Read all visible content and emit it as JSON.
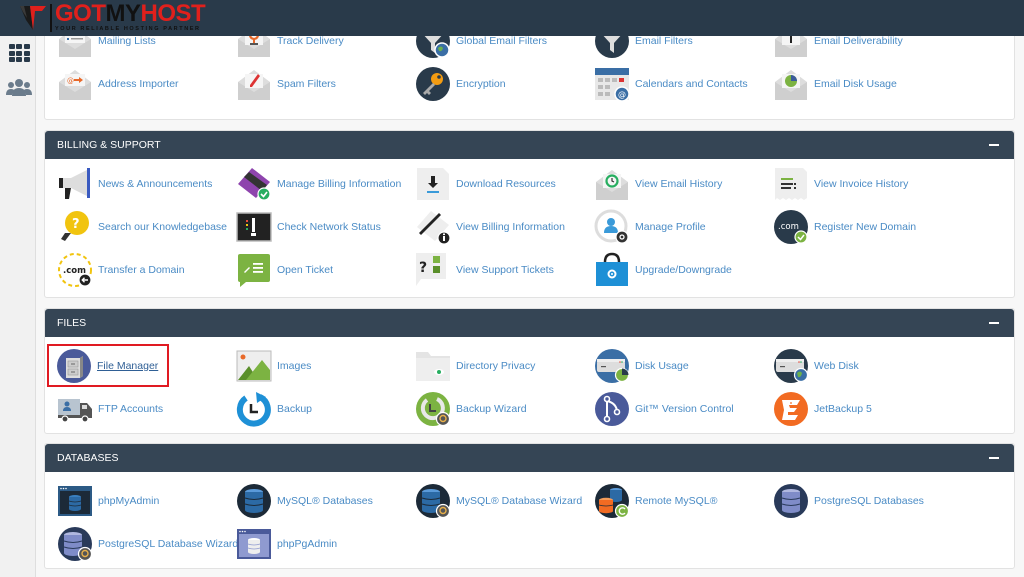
{
  "brand": {
    "name_part1": "GOT",
    "name_part2": "MY",
    "name_part3": "HOST",
    "tagline": "YOUR RELIABLE HOSTING PARTNER",
    "primary_color": "#e0201c",
    "header_color": "#293a4a"
  },
  "sidebar": {
    "items": [
      {
        "icon": "grid-icon",
        "label": "Tools"
      },
      {
        "icon": "users-icon",
        "label": "Users"
      }
    ]
  },
  "email_section_partial": {
    "items": [
      {
        "label": "Mailing Lists",
        "icon": "mailing-lists-icon"
      },
      {
        "label": "Track Delivery",
        "icon": "track-delivery-icon"
      },
      {
        "label": "Global Email Filters",
        "icon": "global-email-filters-icon"
      },
      {
        "label": "Email Filters",
        "icon": "email-filters-icon"
      },
      {
        "label": "Email Deliverability",
        "icon": "email-deliverability-icon"
      },
      {
        "label": "Address Importer",
        "icon": "address-importer-icon"
      },
      {
        "label": "Spam Filters",
        "icon": "spam-filters-icon"
      },
      {
        "label": "Encryption",
        "icon": "encryption-icon"
      },
      {
        "label": "Calendars and Contacts",
        "icon": "calendars-contacts-icon"
      },
      {
        "label": "Email Disk Usage",
        "icon": "email-disk-usage-icon"
      }
    ]
  },
  "billing": {
    "title": "BILLING & SUPPORT",
    "items": [
      {
        "label": "News & Announcements",
        "icon": "megaphone-icon"
      },
      {
        "label": "Manage Billing Information",
        "icon": "credit-card-check-icon"
      },
      {
        "label": "Download Resources",
        "icon": "download-icon"
      },
      {
        "label": "View Email History",
        "icon": "email-history-icon"
      },
      {
        "label": "View Invoice History",
        "icon": "invoice-icon"
      },
      {
        "label": "Search our Knowledgebase",
        "icon": "lightbulb-icon"
      },
      {
        "label": "Check Network Status",
        "icon": "network-status-icon"
      },
      {
        "label": "View Billing Information",
        "icon": "billing-info-icon"
      },
      {
        "label": "Manage Profile",
        "icon": "profile-icon"
      },
      {
        "label": "Register New Domain",
        "icon": "register-domain-icon"
      },
      {
        "label": "Transfer a Domain",
        "icon": "transfer-domain-icon"
      },
      {
        "label": "Open Ticket",
        "icon": "open-ticket-icon"
      },
      {
        "label": "View Support Tickets",
        "icon": "support-tickets-icon"
      },
      {
        "label": "Upgrade/Downgrade",
        "icon": "upgrade-bag-icon"
      }
    ]
  },
  "files": {
    "title": "FILES",
    "items": [
      {
        "label": "File Manager",
        "icon": "file-manager-icon",
        "highlighted": true
      },
      {
        "label": "Images",
        "icon": "images-icon"
      },
      {
        "label": "Directory Privacy",
        "icon": "directory-privacy-icon"
      },
      {
        "label": "Disk Usage",
        "icon": "disk-usage-icon"
      },
      {
        "label": "Web Disk",
        "icon": "web-disk-icon"
      },
      {
        "label": "FTP Accounts",
        "icon": "ftp-truck-icon"
      },
      {
        "label": "Backup",
        "icon": "backup-icon"
      },
      {
        "label": "Backup Wizard",
        "icon": "backup-wizard-icon"
      },
      {
        "label": "Git™ Version Control",
        "icon": "git-icon"
      },
      {
        "label": "JetBackup 5",
        "icon": "jetbackup-icon"
      }
    ]
  },
  "databases": {
    "title": "DATABASES",
    "items": [
      {
        "label": "phpMyAdmin",
        "icon": "phpmyadmin-icon"
      },
      {
        "label": "MySQL® Databases",
        "icon": "mysql-databases-icon"
      },
      {
        "label": "MySQL® Database Wizard",
        "icon": "mysql-wizard-icon"
      },
      {
        "label": "Remote MySQL®",
        "icon": "remote-mysql-icon"
      },
      {
        "label": "PostgreSQL Databases",
        "icon": "postgresql-databases-icon"
      },
      {
        "label": "PostgreSQL Database Wizard",
        "icon": "postgresql-wizard-icon"
      },
      {
        "label": "phpPgAdmin",
        "icon": "phppgadmin-icon"
      }
    ]
  }
}
